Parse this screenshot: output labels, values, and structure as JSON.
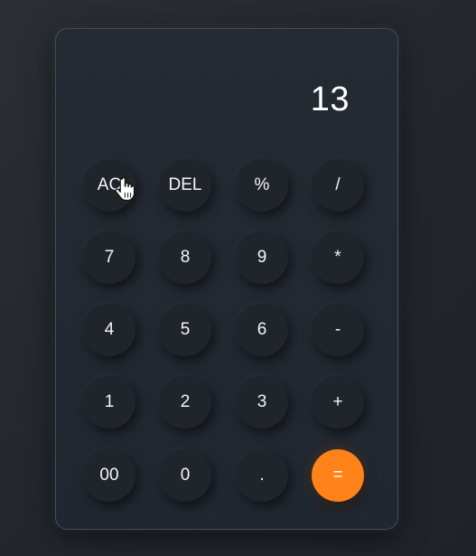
{
  "display": {
    "value": "13"
  },
  "keys": {
    "ac": "AC",
    "del": "DEL",
    "percent": "%",
    "divide": "/",
    "seven": "7",
    "eight": "8",
    "nine": "9",
    "multiply": "*",
    "four": "4",
    "five": "5",
    "six": "6",
    "minus": "-",
    "one": "1",
    "two": "2",
    "three": "3",
    "plus": "+",
    "double_zero": "00",
    "zero": "0",
    "decimal": ".",
    "equals": "="
  },
  "colors": {
    "accent": "#ff8318",
    "panel": "#232931",
    "key": "#20252c",
    "text": "#f4f6f8"
  },
  "icons": {
    "cursor": "hand-pointer-icon"
  }
}
